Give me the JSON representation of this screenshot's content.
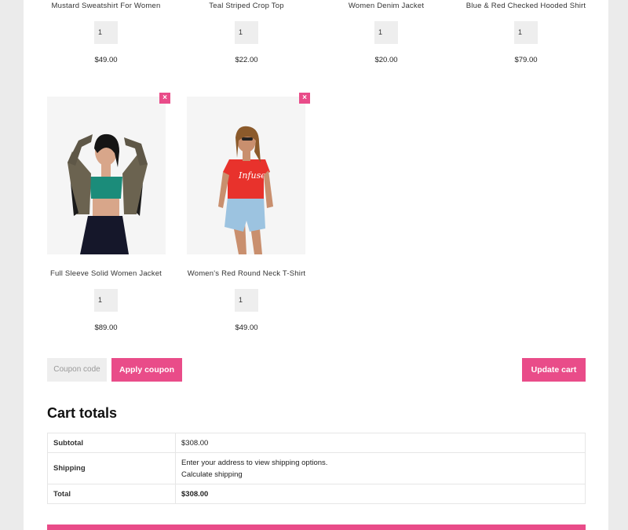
{
  "top_products": [
    {
      "name": "Mustard Sweatshirt For Women",
      "qty": "1",
      "price": "$49.00"
    },
    {
      "name": "Teal Striped Crop Top",
      "qty": "1",
      "price": "$22.00"
    },
    {
      "name": "Women Denim Jacket",
      "qty": "1",
      "price": "$20.00"
    },
    {
      "name": "Blue & Red Checked Hooded Shirt",
      "qty": "1",
      "price": "$79.00"
    }
  ],
  "products": [
    {
      "name": "Full Sleeve Solid Women Jacket",
      "qty": "1",
      "price": "$89.00",
      "remove": "×"
    },
    {
      "name": "Women's Red Round Neck T-Shirt",
      "qty": "1",
      "price": "$49.00",
      "remove": "×"
    }
  ],
  "coupon": {
    "placeholder": "Coupon code",
    "apply_label": "Apply coupon"
  },
  "update_label": "Update cart",
  "totals": {
    "title": "Cart totals",
    "subtotal_label": "Subtotal",
    "subtotal_value": "$308.00",
    "shipping_label": "Shipping",
    "shipping_text": "Enter your address to view shipping options.",
    "shipping_link": "Calculate shipping",
    "total_label": "Total",
    "total_value": "$308.00"
  },
  "colors": {
    "accent": "#e94c89",
    "background": "#ebebeb",
    "field": "#eeeeee"
  }
}
